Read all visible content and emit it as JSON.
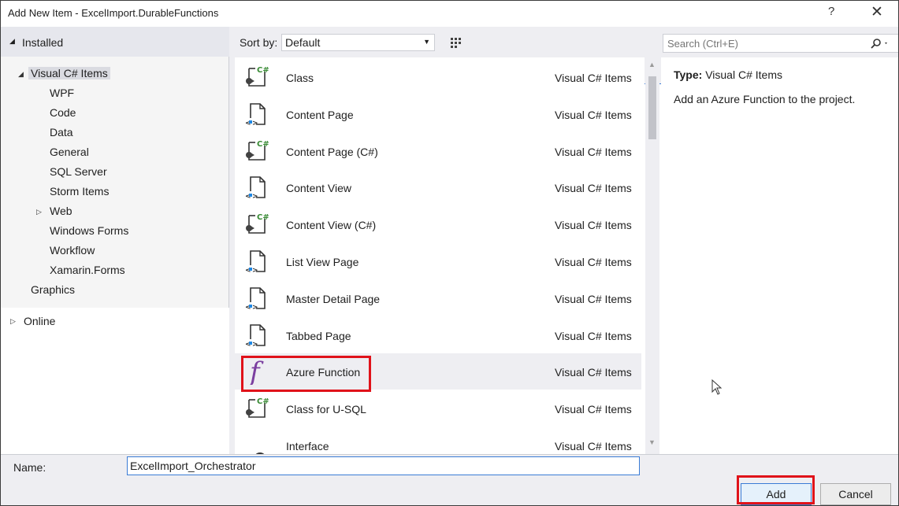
{
  "window": {
    "title": "Add New Item - ExcelImport.DurableFunctions",
    "help": "?",
    "close": "✕"
  },
  "left": {
    "installed": "Installed",
    "tree": [
      {
        "label": "Visual C# Items",
        "selected": true
      },
      {
        "label": "WPF"
      },
      {
        "label": "Code"
      },
      {
        "label": "Data"
      },
      {
        "label": "General"
      },
      {
        "label": "SQL Server"
      },
      {
        "label": "Storm Items"
      },
      {
        "label": "Web"
      },
      {
        "label": "Windows Forms"
      },
      {
        "label": "Workflow"
      },
      {
        "label": "Xamarin.Forms"
      },
      {
        "label": "Graphics"
      }
    ],
    "online": "Online"
  },
  "sort": {
    "label": "Sort by:",
    "value": "Default"
  },
  "items": [
    {
      "name": "Class",
      "category": "Visual C# Items",
      "icon": "csharp-class-icon"
    },
    {
      "name": "Content Page",
      "category": "Visual C# Items",
      "icon": "xaml-page-icon"
    },
    {
      "name": "Content Page (C#)",
      "category": "Visual C# Items",
      "icon": "csharp-class-icon"
    },
    {
      "name": "Content View",
      "category": "Visual C# Items",
      "icon": "xaml-page-icon"
    },
    {
      "name": "Content View (C#)",
      "category": "Visual C# Items",
      "icon": "csharp-class-icon"
    },
    {
      "name": "List View Page",
      "category": "Visual C# Items",
      "icon": "xaml-page-icon"
    },
    {
      "name": "Master Detail Page",
      "category": "Visual C# Items",
      "icon": "xaml-page-icon"
    },
    {
      "name": "Tabbed Page",
      "category": "Visual C# Items",
      "icon": "xaml-page-icon"
    },
    {
      "name": "Azure Function",
      "category": "Visual C# Items",
      "icon": "azure-function-icon"
    },
    {
      "name": "Class for U-SQL",
      "category": "Visual C# Items",
      "icon": "csharp-class-icon"
    },
    {
      "name": "Interface",
      "category": "Visual C# Items",
      "icon": "interface-icon"
    }
  ],
  "search": {
    "placeholder": "Search (Ctrl+E)"
  },
  "details": {
    "type_label": "Type:",
    "type_value": "Visual C# Items",
    "description": "Add an Azure Function to the project."
  },
  "name_field": {
    "label": "Name:",
    "value": "ExcelImport_Orchestrator"
  },
  "buttons": {
    "add": "Add",
    "cancel": "Cancel"
  },
  "colors": {
    "highlight": "#e0121a",
    "accent": "#3a7bd5",
    "function_purple": "#7b3fa0",
    "csharp_green": "#388a34"
  }
}
